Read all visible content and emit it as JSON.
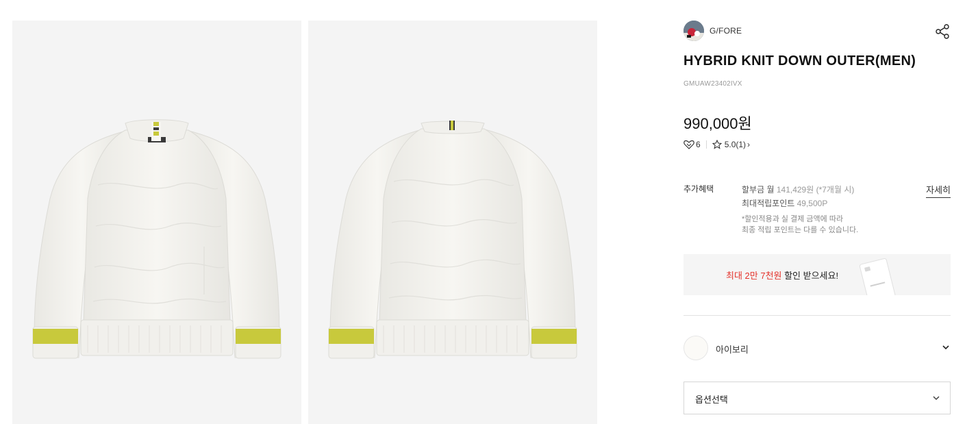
{
  "gallery": {
    "images": [
      {
        "view": "front",
        "colors": {
          "body": "#f3f2ee",
          "stripe": "#c8c93c",
          "tab": "#3a3a3a"
        }
      },
      {
        "view": "back",
        "colors": {
          "body": "#f3f2ee",
          "stripe": "#c8c93c",
          "tab": "#3a3a3a"
        }
      }
    ]
  },
  "brand": {
    "name": "G/FORE",
    "logo_icon": "brand-logo-icon"
  },
  "product": {
    "title": "HYBRID KNIT DOWN OUTER(MEN)",
    "sku": "GMUAW23402IVX",
    "price": "990,000원",
    "likes": "6",
    "rating": "5.0",
    "review_count": "(1)",
    "rating_chevron": "›"
  },
  "benefits": {
    "label": "추가혜택",
    "installment_label": "할부금 월 ",
    "installment_value": "141,429원 (*7개월 시)",
    "points_label": "최대적립포인트 ",
    "points_value": "49,500P",
    "note_line1": "*할인적용과 실 결제 금액에 따라",
    "note_line2": "최종 적립 포인트는 다를 수 있습니다.",
    "detail_link": "자세히"
  },
  "banner": {
    "highlight": "최대 2만 7천원",
    "rest": " 할인 받으세요!"
  },
  "color_option": {
    "label": "아이보리",
    "swatch_color": "#fbfaf7"
  },
  "option_select": {
    "label": "옵션선택"
  },
  "colors": {
    "accent_red": "#e4322b",
    "text": "#222222",
    "muted": "#999999"
  }
}
